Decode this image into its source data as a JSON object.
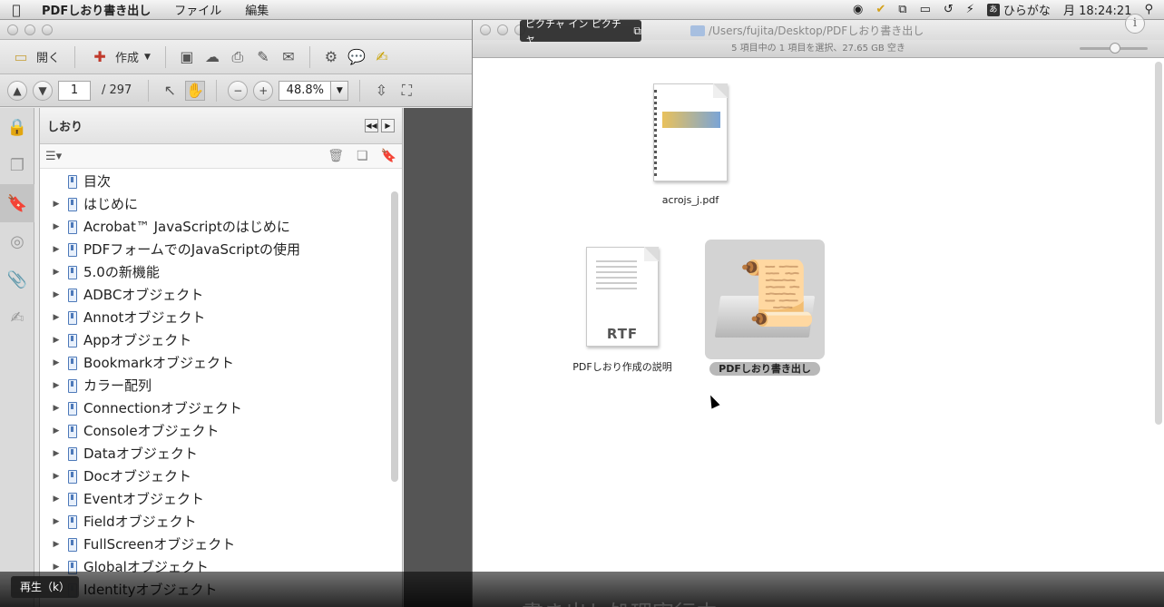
{
  "menubar": {
    "apple": "",
    "app_name": "PDFしおり書き出し",
    "menus": [
      "ファイル",
      "編集"
    ],
    "status_icons": [
      "eye-icon",
      "checkmark-icon",
      "mirror-icon",
      "display-icon",
      "time-machine-icon",
      "bolt-icon"
    ],
    "ime_label": "ひらがな",
    "clock": "月 18:24:21",
    "search_icon": "search-icon"
  },
  "pip": {
    "label": "ピクチャ イン ピクチャ"
  },
  "acrobat": {
    "toolbar": {
      "open_label": "開く",
      "create_label": "作成"
    },
    "nav": {
      "page_current": "1",
      "page_total": "/  297",
      "zoom": "48.8%"
    },
    "bookmarks_panel": {
      "title": "しおり",
      "items": [
        {
          "label": "目次",
          "expandable": false
        },
        {
          "label": "はじめに",
          "expandable": true
        },
        {
          "label": "Acrobat™ JavaScriptのはじめに",
          "expandable": true
        },
        {
          "label": "PDFフォームでのJavaScriptの使用",
          "expandable": true
        },
        {
          "label": "5.0の新機能",
          "expandable": true
        },
        {
          "label": "ADBCオブジェクト",
          "expandable": true
        },
        {
          "label": "Annotオブジェクト",
          "expandable": true
        },
        {
          "label": "Appオブジェクト",
          "expandable": true
        },
        {
          "label": "Bookmarkオブジェクト",
          "expandable": true
        },
        {
          "label": "カラー配列",
          "expandable": true
        },
        {
          "label": "Connectionオブジェクト",
          "expandable": true
        },
        {
          "label": "Consoleオブジェクト",
          "expandable": true
        },
        {
          "label": "Dataオブジェクト",
          "expandable": true
        },
        {
          "label": "Docオブジェクト",
          "expandable": true
        },
        {
          "label": "Eventオブジェクト",
          "expandable": true
        },
        {
          "label": "Fieldオブジェクト",
          "expandable": true
        },
        {
          "label": "FullScreenオブジェクト",
          "expandable": true
        },
        {
          "label": "Globalオブジェクト",
          "expandable": true
        },
        {
          "label": "Identityオブジェクト",
          "expandable": true
        }
      ]
    }
  },
  "finder": {
    "path": "/Users/fujita/Desktop/PDFしおり書き出し",
    "status": "5 項目中の 1 項目を選択、27.65 GB 空き",
    "files": [
      {
        "name": "acrojs_j.pdf",
        "kind": "pdf"
      },
      {
        "name": "PDFしおり作成の説明",
        "kind": "rtf",
        "badge": "RTF"
      },
      {
        "name": "PDFしおり書き出し",
        "kind": "app",
        "selected": true
      }
    ]
  },
  "player": {
    "play_tooltip": "再生（k）",
    "subtitle": "書き出し処理実行中"
  }
}
